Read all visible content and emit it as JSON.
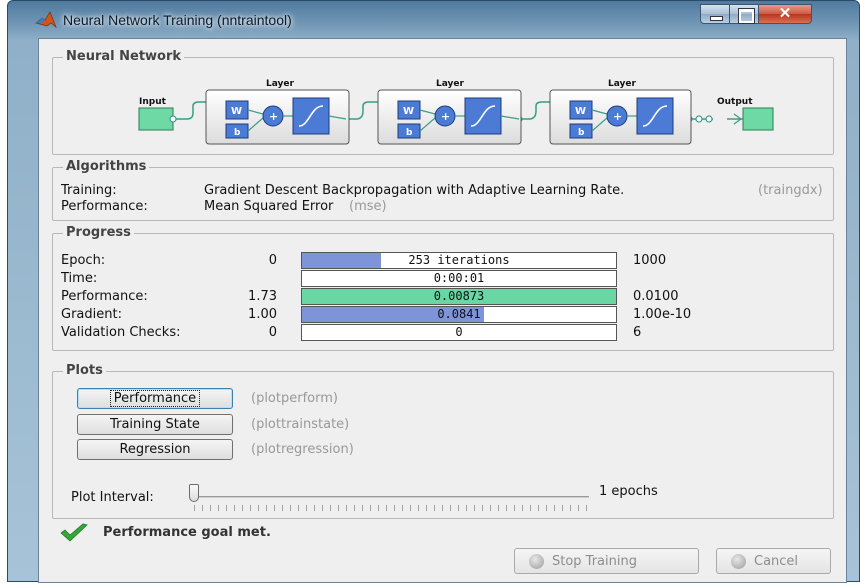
{
  "window": {
    "title": "Neural Network Training (nntraintool)"
  },
  "network": {
    "legend": "Neural Network",
    "input_label": "Input",
    "output_label": "Output",
    "layers": [
      {
        "label": "Layer",
        "weight": "W",
        "bias": "b",
        "sum": "+"
      },
      {
        "label": "Layer",
        "weight": "W",
        "bias": "b",
        "sum": "+"
      },
      {
        "label": "Layer",
        "weight": "W",
        "bias": "b",
        "sum": "+"
      }
    ]
  },
  "algorithms": {
    "legend": "Algorithms",
    "training_label": "Training:",
    "training_value": "Gradient Descent Backpropagation with Adaptive Learning Rate.",
    "training_fn": "(traingdx)",
    "performance_label": "Performance:",
    "performance_value": "Mean Squared Error",
    "performance_fn": "(mse)"
  },
  "progress": {
    "legend": "Progress",
    "rows": [
      {
        "label": "Epoch:",
        "start": "0",
        "bar_text": "253 iterations",
        "end": "1000",
        "fill_pct": 25.3,
        "fill_color": "#7d95d8"
      },
      {
        "label": "Time:",
        "start": "",
        "bar_text": "0:00:01",
        "end": "",
        "fill_pct": 0,
        "fill_color": "#7d95d8"
      },
      {
        "label": "Performance:",
        "start": "1.73",
        "bar_text": "0.00873",
        "end": "0.0100",
        "fill_pct": 100,
        "fill_color": "#69d6a4"
      },
      {
        "label": "Gradient:",
        "start": "1.00",
        "bar_text": "0.0841",
        "end": "1.00e-10",
        "fill_pct": 58,
        "fill_color": "#7d95d8"
      },
      {
        "label": "Validation Checks:",
        "start": "0",
        "bar_text": "0",
        "end": "6",
        "fill_pct": 0,
        "fill_color": "#7d95d8"
      }
    ]
  },
  "plots": {
    "legend": "Plots",
    "buttons": [
      {
        "label": "Performance",
        "fn": "(plotperform)"
      },
      {
        "label": "Training State",
        "fn": "(plottrainstate)"
      },
      {
        "label": "Regression",
        "fn": "(plotregression)"
      }
    ],
    "interval_label": "Plot Interval:",
    "interval_value": "1 epochs",
    "slider_fraction": 0
  },
  "status": {
    "message": "Performance goal met."
  },
  "footer": {
    "stop_label": "Stop Training",
    "cancel_label": "Cancel"
  },
  "colors": {
    "accent_green": "#35a73a",
    "input_output_fill": "#6fd9a6",
    "block_blue": "#4c7bd6"
  }
}
